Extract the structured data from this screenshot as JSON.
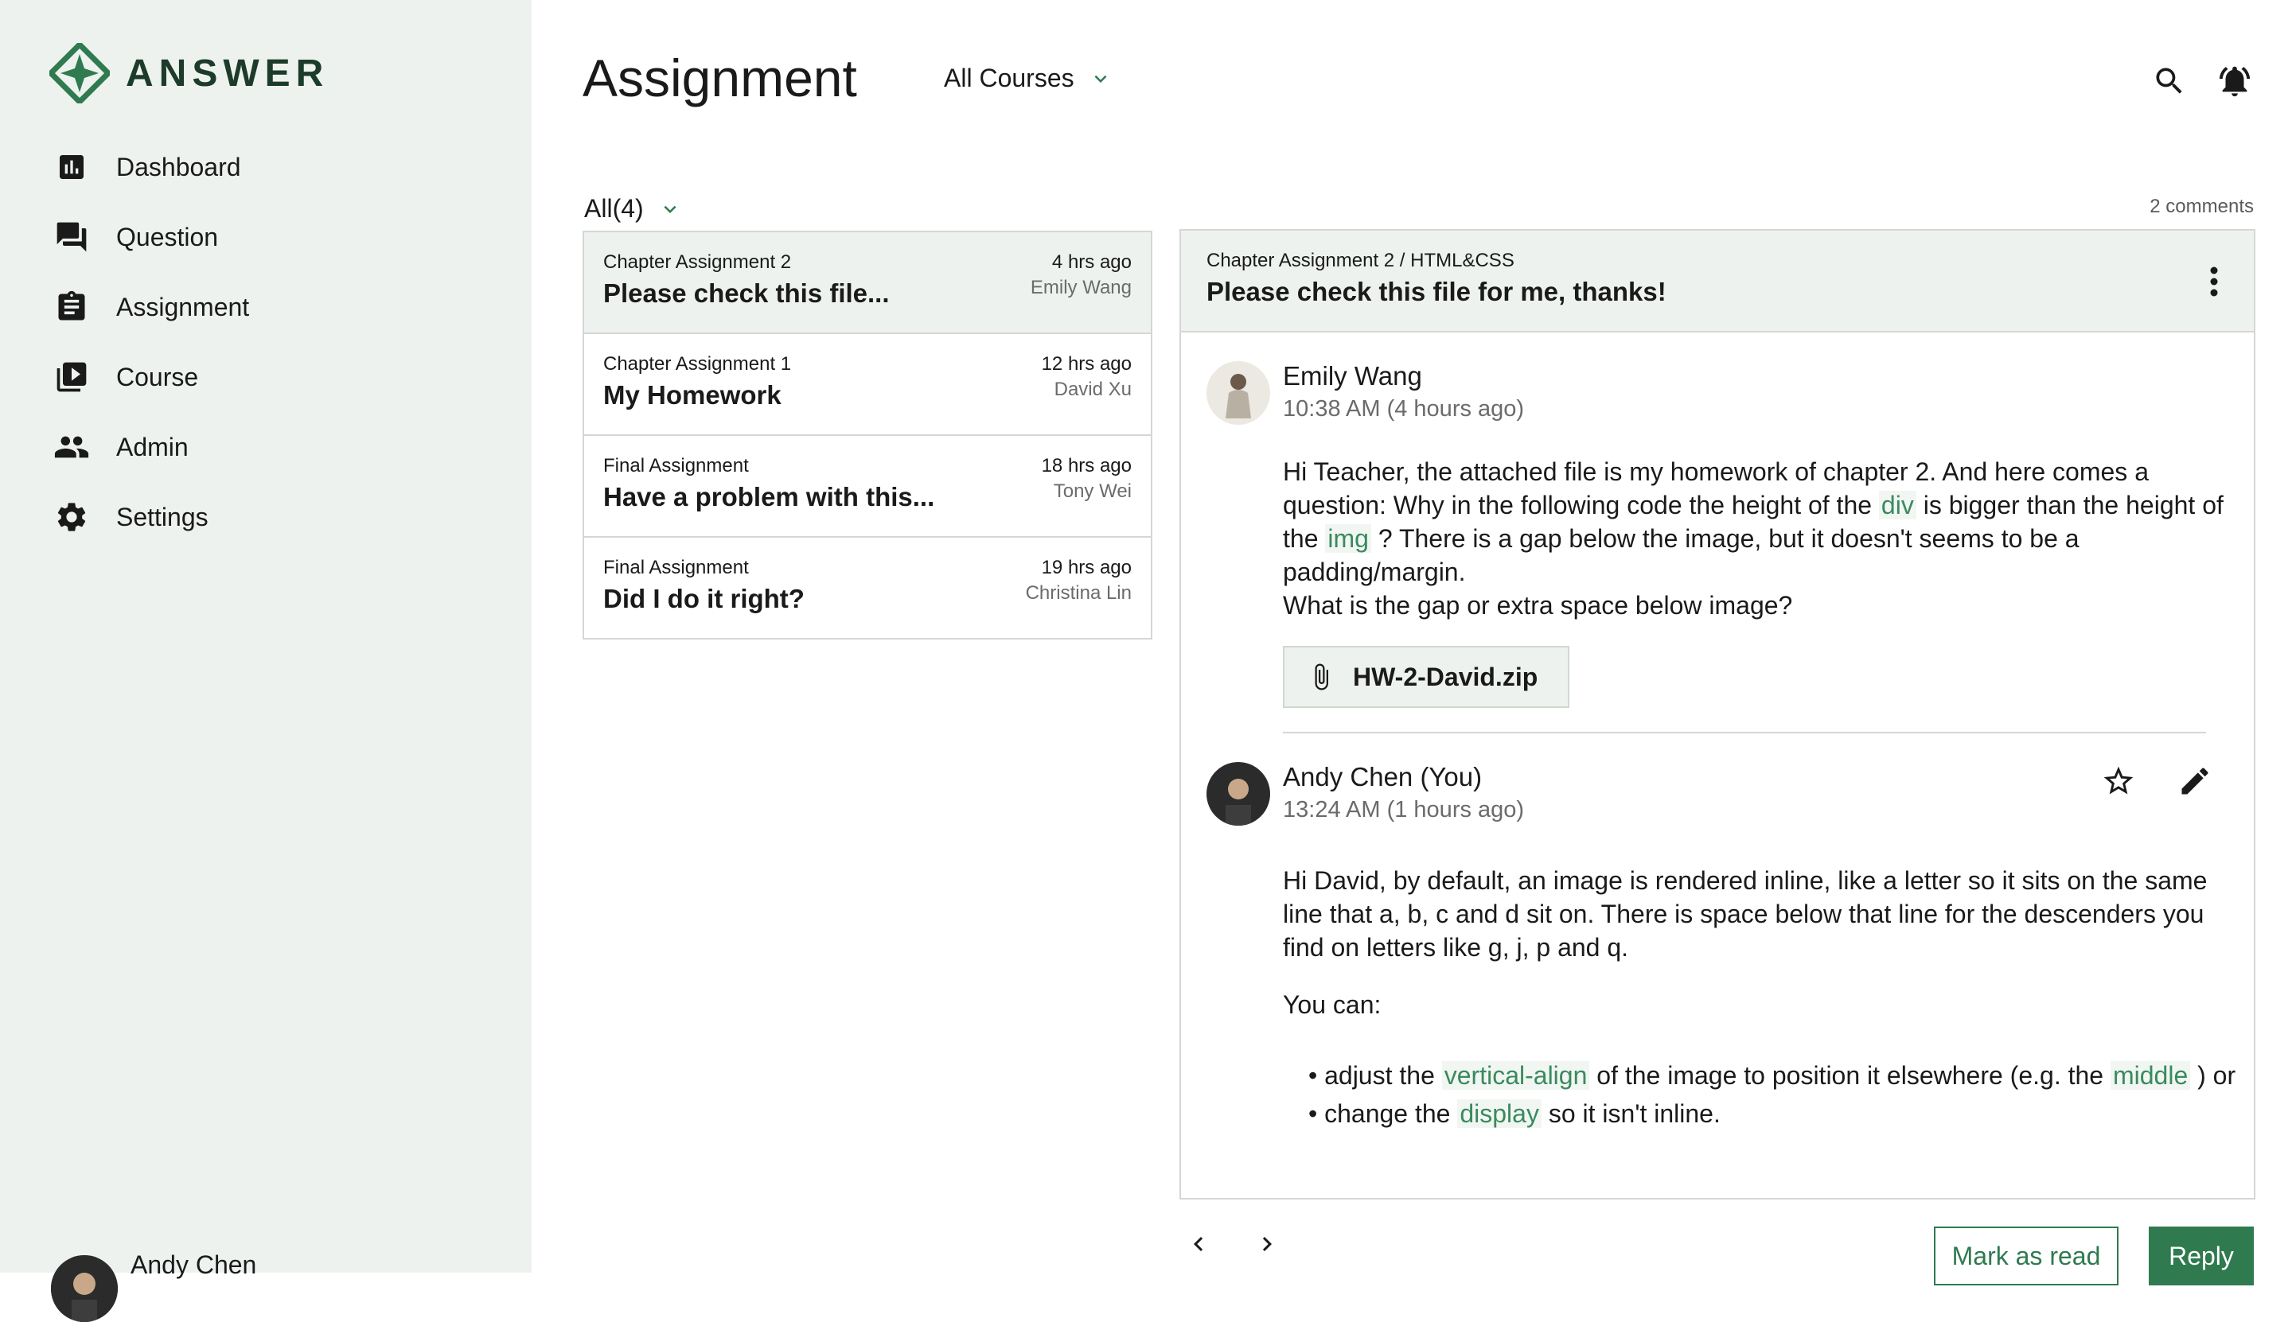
{
  "app": {
    "name": "ANSWER",
    "brand_color": "#2f7a4f",
    "sidebar_bg": "#eef2ee"
  },
  "sidebar": {
    "items": [
      {
        "label": "Dashboard",
        "icon": "bar-chart-icon"
      },
      {
        "label": "Question",
        "icon": "forum-icon"
      },
      {
        "label": "Assignment",
        "icon": "clipboard-icon"
      },
      {
        "label": "Course",
        "icon": "video-library-icon"
      },
      {
        "label": "Admin",
        "icon": "people-icon"
      },
      {
        "label": "Settings",
        "icon": "gear-icon"
      }
    ],
    "user": {
      "name": "Andy Chen"
    }
  },
  "header": {
    "title": "Assignment",
    "course_filter": "All Courses",
    "icons": [
      "search-icon",
      "bell-icon"
    ]
  },
  "list": {
    "filter": "All(4)",
    "items": [
      {
        "course": "Chapter Assignment 2",
        "title": "Please check this file...",
        "time": "4 hrs ago",
        "author": "Emily Wang"
      },
      {
        "course": "Chapter Assignment 1",
        "title": "My Homework",
        "time": "12 hrs ago",
        "author": "David Xu"
      },
      {
        "course": "Final Assignment",
        "title": "Have a problem with this...",
        "time": "18 hrs ago",
        "author": "Tony Wei"
      },
      {
        "course": "Final Assignment",
        "title": "Did I do it right?",
        "time": "19 hrs ago",
        "author": "Christina Lin"
      }
    ]
  },
  "detail": {
    "comments_count": "2 comments",
    "breadcrumb": "Chapter Assignment 2 / HTML&CSS",
    "title": "Please check this file for me, thanks!",
    "question": {
      "author": "Emily Wang",
      "time": "10:38 AM (4 hours ago)",
      "p1_a": "Hi Teacher, the attached file is my homework of chapter 2. And here comes a question: Why in the following code the height of the ",
      "code_div": "div",
      "p1_b": " is bigger than the height of the ",
      "code_img": "img",
      "p1_c": " ? There is a gap below the image, but it doesn't seems to be a padding/margin.",
      "p2": "What is the gap or extra space below image?",
      "attachment": "HW-2-David.zip"
    },
    "reply": {
      "author": "Andy Chen (You)",
      "time": "13:24 AM (1 hours ago)",
      "p1": "Hi David, by default, an image is rendered inline, like a letter so it sits on the same line that a, b, c and d sit on. There is space below that line for the descenders you find on letters like g, j, p and q.",
      "p2": "You can:",
      "b1_a": "• adjust the ",
      "b1_code": "vertical-align",
      "b1_b": " of the image to position it elsewhere (e.g. the ",
      "b1_code2": "middle",
      "b1_c": " ) or",
      "b2_a": "• change the ",
      "b2_code": "display",
      "b2_b": " so it isn't inline."
    }
  },
  "actions": {
    "mark_read": "Mark as read",
    "reply": "Reply"
  }
}
